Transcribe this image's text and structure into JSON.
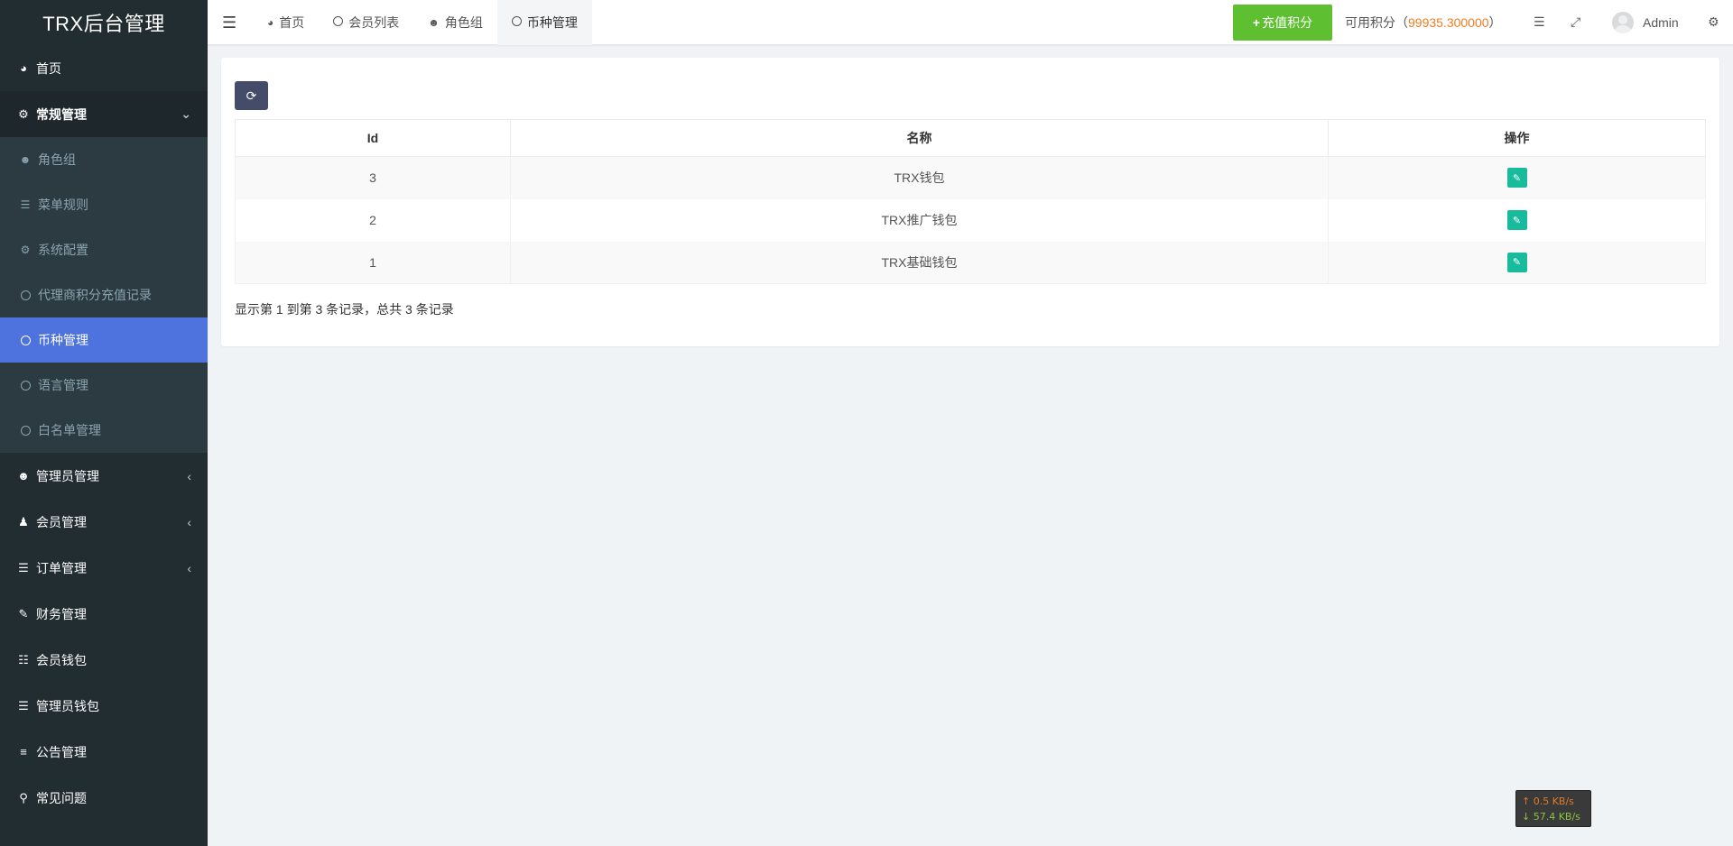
{
  "app": {
    "title": "TRX后台管理"
  },
  "sidebar": {
    "items": [
      {
        "label": "首页",
        "icon": "dashboard-icon"
      },
      {
        "label": "常规管理",
        "icon": "cogs-icon",
        "expanded": true
      }
    ],
    "submenu": [
      {
        "label": "角色组",
        "icon": "group-icon"
      },
      {
        "label": "菜单规则",
        "icon": "list-icon"
      },
      {
        "label": "系统配置",
        "icon": "gear-icon"
      },
      {
        "label": "代理商积分充值记录",
        "icon": "circle-icon"
      },
      {
        "label": "币种管理",
        "icon": "circle-icon",
        "active": true
      },
      {
        "label": "语言管理",
        "icon": "circle-icon"
      },
      {
        "label": "白名单管理",
        "icon": "circle-icon"
      }
    ],
    "bottom": [
      {
        "label": "管理员管理",
        "icon": "group-icon"
      },
      {
        "label": "会员管理",
        "icon": "user-icon"
      },
      {
        "label": "订单管理",
        "icon": "list-icon"
      },
      {
        "label": "财务管理",
        "icon": "edit-icon"
      },
      {
        "label": "会员钱包",
        "icon": "indent-icon"
      },
      {
        "label": "管理员钱包",
        "icon": "list-ul-icon"
      },
      {
        "label": "公告管理",
        "icon": "bars-icon"
      },
      {
        "label": "常见问题",
        "icon": "search-icon"
      }
    ]
  },
  "header": {
    "tabs": [
      {
        "label": "首页",
        "icon": "dashboard-icon"
      },
      {
        "label": "会员列表",
        "icon": "circle-icon"
      },
      {
        "label": "角色组",
        "icon": "group-icon"
      },
      {
        "label": "币种管理",
        "icon": "circle-icon",
        "active": true
      }
    ],
    "recharge_label": "充值积分",
    "points_label": "可用积分（",
    "points_value": "99935.300000",
    "points_suffix": "）",
    "username": "Admin"
  },
  "table": {
    "columns": [
      "Id",
      "名称",
      "操作"
    ],
    "rows": [
      {
        "id": "3",
        "name": "TRX钱包"
      },
      {
        "id": "2",
        "name": "TRX推广钱包"
      },
      {
        "id": "1",
        "name": "TRX基础钱包"
      }
    ],
    "footer": "显示第 1 到第 3 条记录，总共 3 条记录"
  },
  "netspeed": {
    "up": "0.5 KB/s",
    "down": "57.4 KB/s"
  },
  "colors": {
    "sidebar": "#222d32",
    "active": "#4e73df",
    "success": "#18bc9c",
    "recharge": "#5ec030",
    "points": "#f07c22"
  }
}
